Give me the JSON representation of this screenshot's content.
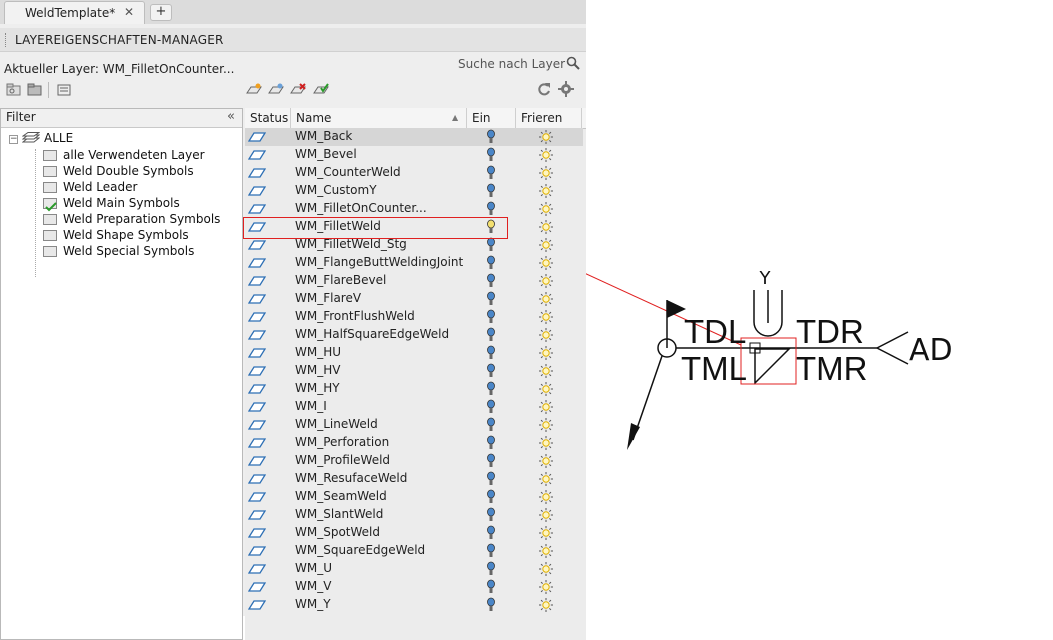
{
  "tabs": {
    "active_label": "WeldTemplate*",
    "close_glyph": "✕",
    "new_glyph": "+"
  },
  "panel": {
    "title": "LAYEREIGENSCHAFTEN-MANAGER",
    "current_layer": "Aktueller Layer: WM_FilletOnCounter...",
    "search_placeholder": "Suche nach Layer"
  },
  "filter": {
    "header": "Filter",
    "collapse_glyph": "«",
    "root": "ALLE",
    "items": [
      "alle Verwendeten Layer",
      "Weld Double Symbols",
      "Weld Leader",
      "Weld Main Symbols",
      "Weld Preparation Symbols",
      "Weld Shape Symbols",
      "Weld Special Symbols"
    ]
  },
  "columns": {
    "status": "Status",
    "name": "Name",
    "on": "Ein",
    "freeze": "Frieren"
  },
  "layers": [
    "WM_Back",
    "WM_Bevel",
    "WM_CounterWeld",
    "WM_CustomY",
    "WM_FilletOnCounter...",
    "WM_FilletWeld",
    "WM_FilletWeld_Stg",
    "WM_FlangeButtWeldingJoint",
    "WM_FlareBevel",
    "WM_FlareV",
    "WM_FrontFlushWeld",
    "WM_HalfSquareEdgeWeld",
    "WM_HU",
    "WM_HV",
    "WM_HY",
    "WM_I",
    "WM_LineWeld",
    "WM_Perforation",
    "WM_ProfileWeld",
    "WM_ResufaceWeld",
    "WM_SeamWeld",
    "WM_SlantWeld",
    "WM_SpotWeld",
    "WM_SquareEdgeWeld",
    "WM_U",
    "WM_V",
    "WM_Y"
  ],
  "drawing": {
    "label_y": "Y",
    "label_tdl": "TDL",
    "label_tdr": "TDR",
    "label_tml": "TML",
    "label_tmr": "TMR",
    "label_ad": "AD"
  },
  "colors": {
    "highlight": "#e02020",
    "status_icon": "#2d6fb5",
    "bulb_on": "#4a86c8",
    "bulb_active": "#f4e070",
    "sun": "#e0b000"
  },
  "icons": {
    "tab_close": "close-icon",
    "new_tab": "plus-icon",
    "search": "search-icon",
    "refresh": "refresh-icon",
    "settings": "gear-icon"
  }
}
